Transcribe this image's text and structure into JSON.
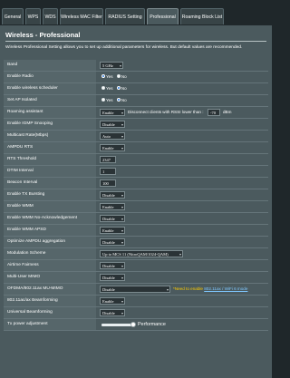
{
  "tabs": [
    {
      "label": "General",
      "active": false
    },
    {
      "label": "WPS",
      "active": false
    },
    {
      "label": "WDS",
      "active": false
    },
    {
      "label": "Wireless MAC Filter",
      "active": false
    },
    {
      "label": "RADIUS Setting",
      "active": false
    },
    {
      "label": "Professional",
      "active": true
    },
    {
      "label": "Roaming Block List",
      "active": false
    }
  ],
  "page": {
    "title": "Wireless - Professional",
    "description": "Wireless Professional Setting allows you to set up additional parameters for wireless. But default values are recommended."
  },
  "settings": {
    "band": {
      "label": "Band",
      "value": "5 GHz"
    },
    "enable_radio": {
      "label": "Enable Radio",
      "yes": "Yes",
      "no": "No",
      "selected": "Yes"
    },
    "wireless_scheduler": {
      "label": "Enable wireless scheduler",
      "yes": "Yes",
      "no": "No",
      "selected": "No"
    },
    "ap_isolated": {
      "label": "Set AP Isolated",
      "yes": "Yes",
      "no": "No",
      "selected": "No"
    },
    "roaming_assistant": {
      "label": "Roaming assistant",
      "value": "Enable",
      "text": "Disconnect clients with RSSI lower than :",
      "rssi": "-70",
      "unit": "dBm"
    },
    "igmp_snooping": {
      "label": "Enable IGMP Snooping",
      "value": "Disable"
    },
    "multicast_rate": {
      "label": "Multicast Rate(Mbps)",
      "value": "Auto"
    },
    "ampdu_rts": {
      "label": "AMPDU RTS",
      "value": "Enable"
    },
    "rts_threshold": {
      "label": "RTS Threshold",
      "value": "2347"
    },
    "dtim_interval": {
      "label": "DTIM Interval",
      "value": "1"
    },
    "beacon_interval": {
      "label": "Beacon Interval",
      "value": "100"
    },
    "tx_bursting": {
      "label": "Enable TX Bursting",
      "value": "Disable"
    },
    "wmm": {
      "label": "Enable WMM",
      "value": "Enable"
    },
    "wmm_no_ack": {
      "label": "Enable WMM No-Acknowledgement",
      "value": "Disable"
    },
    "wmm_apsd": {
      "label": "Enable WMM APSD",
      "value": "Enable"
    },
    "ampdu_aggregation": {
      "label": "Optimize AMPDU aggregation",
      "value": "Disable"
    },
    "modulation_scheme": {
      "label": "Modulation Scheme",
      "value": "Up to MCS 11 (NitroQAM/1024-QAM)"
    },
    "airtime_fairness": {
      "label": "Airtime Fairness",
      "value": "Disable"
    },
    "multi_user_mimo": {
      "label": "Multi-User MIMO",
      "value": "Disable"
    },
    "ofdma": {
      "label": "OFDMA/802.11ax MU-MIMO",
      "value": "Disable",
      "note_prefix": "*Need to enable ",
      "note_link": "802.11ax / WiFi 6 mode"
    },
    "beamforming_11ac": {
      "label": "802.11ac/ax Beamforming",
      "value": "Enable"
    },
    "universal_beamforming": {
      "label": "Universal Beamforming",
      "value": "Disable"
    },
    "tx_power": {
      "label": "Tx power adjustment",
      "value_label": "Performance",
      "level": 1.0
    }
  },
  "colors": {
    "background": "#1f272a",
    "panel": "#4b5a5e",
    "radio_selected": "#2b78d6",
    "note": "#ffcc00",
    "link": "#7fc7ff"
  },
  "icons": {
    "dropdown": "chevron-down-icon"
  }
}
